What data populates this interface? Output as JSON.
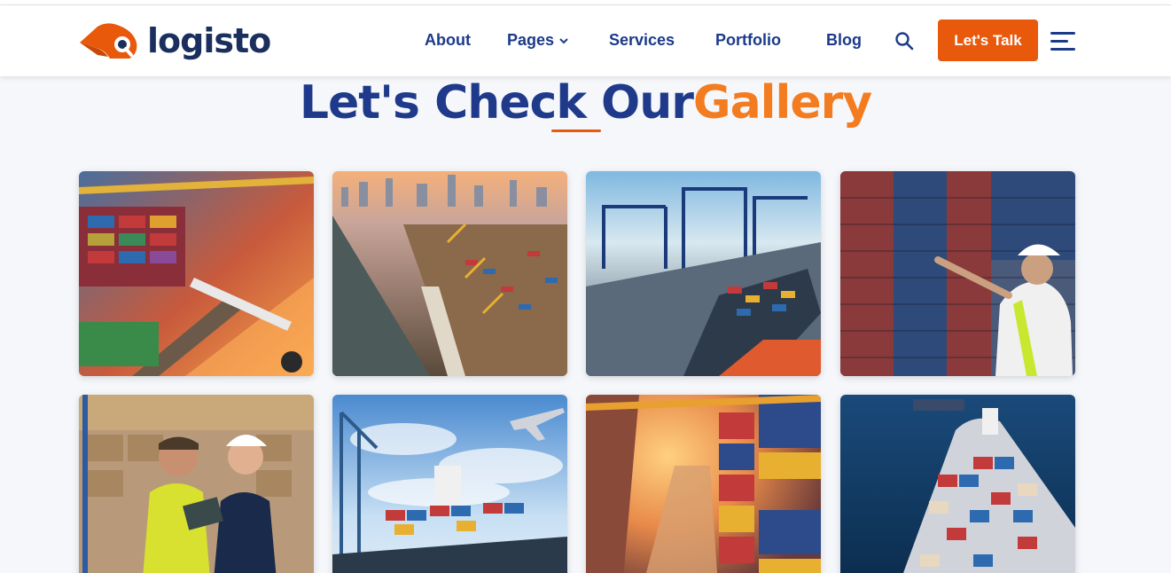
{
  "brand": {
    "name": "logisto"
  },
  "nav": {
    "items": [
      {
        "label": "About"
      },
      {
        "label": "Pages",
        "has_dropdown": true
      },
      {
        "label": "Services"
      },
      {
        "label": "Portfolio"
      },
      {
        "label": "Blog"
      }
    ],
    "search_icon": "search-icon",
    "menu_icon": "hamburger-icon"
  },
  "cta": {
    "label": "Let's Talk"
  },
  "section": {
    "title_main": "Let's Check Our",
    "title_accent": "Gallery"
  },
  "gallery": {
    "images": [
      {
        "subject": "container-terminal-sunset"
      },
      {
        "subject": "harbor-city-aerial"
      },
      {
        "subject": "port-cranes-ship"
      },
      {
        "subject": "worker-pointing-containers"
      },
      {
        "subject": "warehouse-workers-tablet"
      },
      {
        "subject": "cargo-ship-airplane"
      },
      {
        "subject": "container-yard-sunlight"
      },
      {
        "subject": "container-ship-sea"
      }
    ]
  },
  "colors": {
    "brand_dark": "#1a2f5e",
    "nav_blue": "#1b3a8a",
    "accent_orange": "#e8590c",
    "gallery_orange": "#f47c20",
    "page_bg": "#f5f7fa"
  }
}
